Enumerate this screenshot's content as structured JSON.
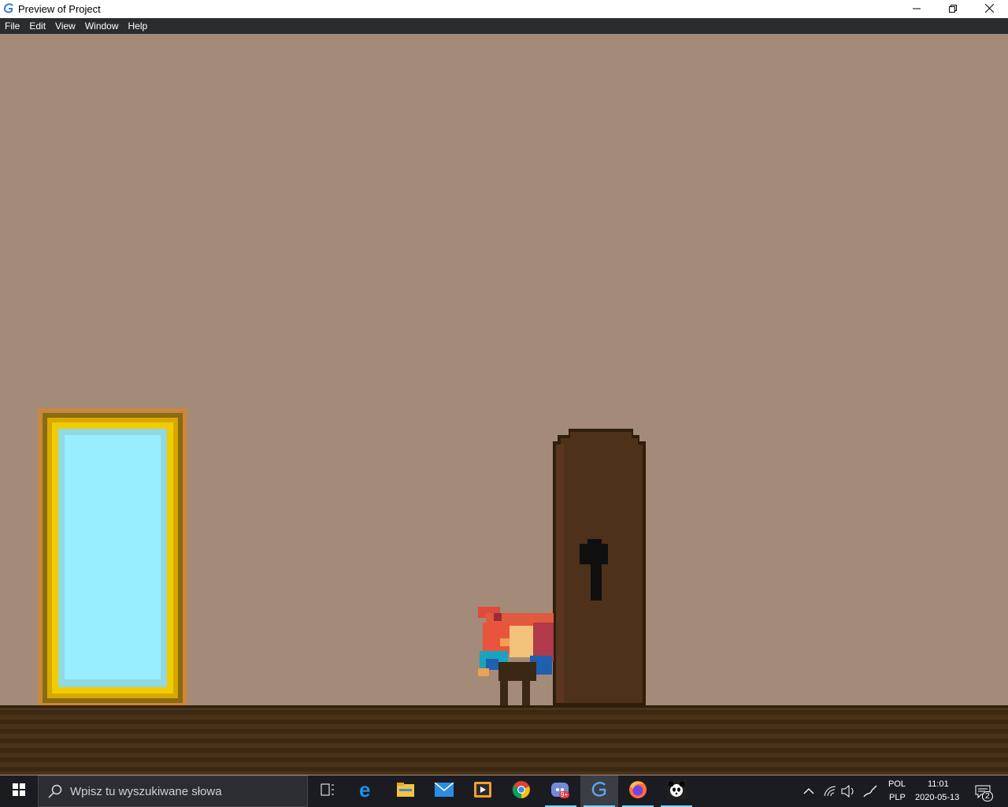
{
  "window": {
    "title": "Preview of Project",
    "minimize_icon": "minimize-icon",
    "maximize_icon": "restore-icon",
    "close_icon": "close-icon"
  },
  "menubar": {
    "items": [
      "File",
      "Edit",
      "View",
      "Window",
      "Help"
    ]
  },
  "game": {
    "background_color": "#a48a78",
    "objects": [
      "mirror-portal",
      "wooden-door",
      "player-character"
    ]
  },
  "taskbar": {
    "search_placeholder": "Wpisz tu wyszukiwane słowa",
    "apps": [
      "task-view-icon",
      "edge-icon",
      "file-explorer-icon",
      "mail-icon",
      "media-player-icon",
      "chrome-icon",
      "discord-icon",
      "game-engine-icon",
      "firefox-icon",
      "panda-app-icon"
    ],
    "discord_badge": "9+",
    "tray": {
      "language_top": "POL",
      "language_bottom": "PLP",
      "time": "11:01",
      "date": "2020-05-13",
      "notification_count": "2"
    }
  }
}
